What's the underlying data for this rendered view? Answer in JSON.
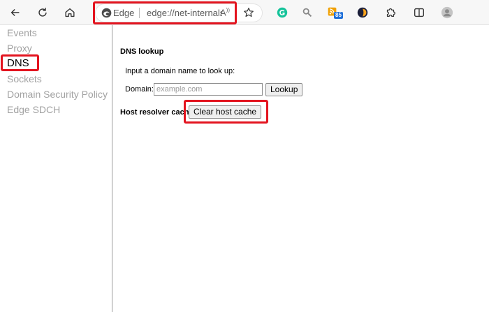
{
  "toolbar": {
    "address_label": "Edge",
    "address_url": "edge://net-internals/#dns",
    "read_aloud_label": "A",
    "extension_badge": "85",
    "icons": [
      "back-icon",
      "refresh-icon",
      "home-icon",
      "edge-logo-icon",
      "read-aloud-icon",
      "favorite-star-icon",
      "grammarly-icon",
      "search-extension-icon",
      "rss-extension-icon",
      "extension-icon",
      "puzzle-icon",
      "split-screen-icon",
      "profile-avatar-icon"
    ]
  },
  "sidebar": {
    "items": [
      {
        "label": "Events"
      },
      {
        "label": "Proxy"
      },
      {
        "label": "DNS"
      },
      {
        "label": "Sockets"
      },
      {
        "label": "Domain Security Policy"
      },
      {
        "label": "Edge SDCH"
      }
    ],
    "active_index": 2
  },
  "main": {
    "dns_lookup": {
      "title": "DNS lookup",
      "instruction": "Input a domain name to look up:",
      "domain_label": "Domain:",
      "domain_value": "",
      "domain_placeholder": "example.com",
      "lookup_button": "Lookup"
    },
    "host_resolver": {
      "label": "Host resolver cache:",
      "clear_button": "Clear host cache"
    }
  },
  "colors": {
    "highlight": "#e3141f",
    "sidebar_inactive": "#a2a2a2",
    "toolbar_bg": "#f7f7f7"
  }
}
